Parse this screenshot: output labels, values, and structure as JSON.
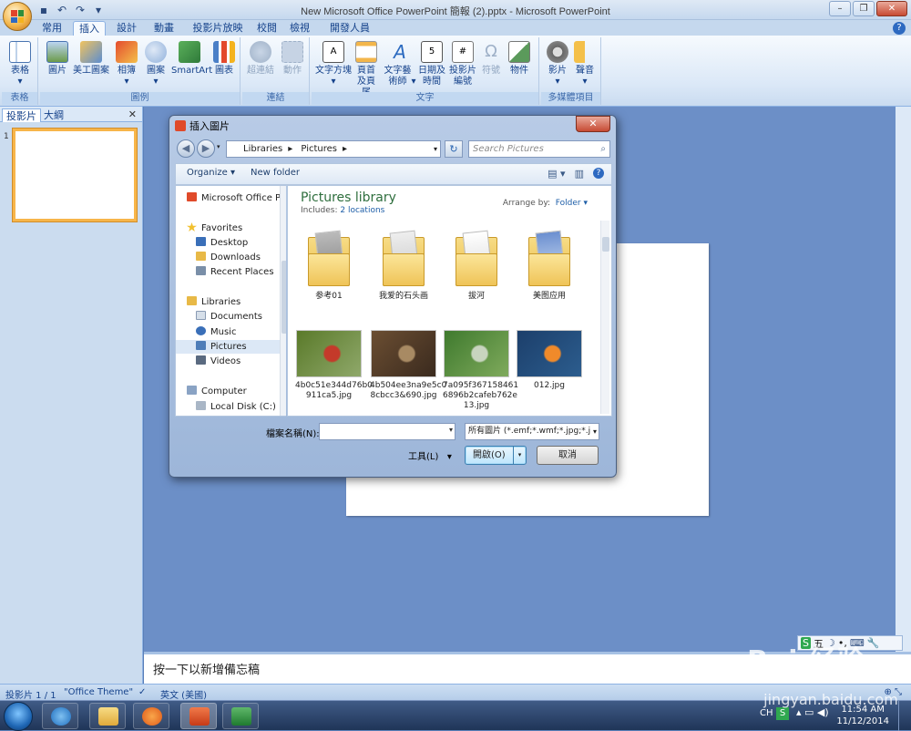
{
  "window": {
    "title": "New Microsoft Office PowerPoint 簡報 (2).pptx - Microsoft PowerPoint"
  },
  "ribbon": {
    "tabs": [
      "常用",
      "插入",
      "設計",
      "動畫",
      "投影片放映",
      "校閱",
      "檢視",
      "開發人員"
    ],
    "active_tab": "插入",
    "groups": {
      "table": {
        "label": "表格",
        "buttons": [
          "表格"
        ]
      },
      "illustrations": {
        "label": "圖例",
        "buttons": [
          "圖片",
          "美工圖案",
          "相簿",
          "圖案",
          "SmartArt",
          "圖表"
        ]
      },
      "links": {
        "label": "連結",
        "buttons": [
          "超連結",
          "動作"
        ]
      },
      "text": {
        "label": "文字",
        "buttons": [
          "文字方塊",
          "頁首及頁尾",
          "文字藝術師",
          "日期及時間",
          "投影片編號",
          "符號",
          "物件"
        ]
      },
      "media": {
        "label": "多媒體項目",
        "buttons": [
          "影片",
          "聲音"
        ]
      }
    }
  },
  "panel": {
    "tabs": [
      "投影片",
      "大綱"
    ],
    "active_tab": "投影片",
    "thumb_number": "1"
  },
  "notes": {
    "placeholder": "按一下以新增備忘稿"
  },
  "statusbar": {
    "slide": "投影片 1 / 1",
    "theme": "\"Office Theme\"",
    "language": "英文 (美國)"
  },
  "dialog": {
    "title": "插入圖片",
    "breadcrumbs": [
      "Libraries",
      "Pictures"
    ],
    "search_placeholder": "Search Pictures",
    "commands": {
      "organize": "Organize",
      "new_folder": "New folder"
    },
    "nav": {
      "top": "Microsoft Office Po",
      "favorites_header": "Favorites",
      "favorites": [
        "Desktop",
        "Downloads",
        "Recent Places"
      ],
      "libraries_header": "Libraries",
      "libraries": [
        "Documents",
        "Music",
        "Pictures",
        "Videos"
      ],
      "selected": "Pictures",
      "computer_header": "Computer",
      "computer": [
        "Local Disk (C:)"
      ]
    },
    "library": {
      "title": "Pictures library",
      "includes_label": "Includes:",
      "includes_link": "2 locations",
      "arrange_label": "Arrange by:",
      "arrange_value": "Folder"
    },
    "folders": [
      "参考01",
      "我爱的石头画",
      "拔河",
      "美图应用"
    ],
    "photos": [
      {
        "name": "4b0c51e344d76b0911ca5.jpg",
        "line1": "4b0c51e344d76b0",
        "line2": "911ca5.jpg",
        "colors": [
          "#5a7a2a",
          "#c43a2a",
          "#8fa86a"
        ]
      },
      {
        "name": "4b504ee3na9e5c08cbcc3&690.jpg",
        "line1": "4b504ee3na9e5c0",
        "line2": "8cbcc3&690.jpg",
        "colors": [
          "#6b4e32",
          "#a88a63",
          "#3a2a1e"
        ]
      },
      {
        "name": "7a095f3671584616896b2cafeb762e13.jpg",
        "line1": "7a095f367158461",
        "line2": "6896b2cafeb762e",
        "line3": "13.jpg",
        "colors": [
          "#3f7a2e",
          "#c8d4bf",
          "#7faa5c"
        ]
      },
      {
        "name": "012.jpg",
        "line1": "012.jpg",
        "colors": [
          "#1c3f6b",
          "#f08a2a",
          "#2c5d8e"
        ]
      }
    ],
    "filename_label": "檔案名稱(N):",
    "filename_value": "",
    "filetype_value": "所有圖片 (*.emf;*.wmf;*.jpg;*.j",
    "tools_label": "工具(L)",
    "open_label": "開啟(O)",
    "cancel_label": "取消"
  },
  "ime": {
    "items": [
      "S",
      "五",
      "☽",
      "•,",
      "⌨",
      "🔧"
    ]
  },
  "taskbar": {
    "lang": "CH",
    "time": "11:54 AM",
    "date": "11/12/2014"
  },
  "watermark": {
    "text1": "Bai 经验",
    "text2": "jingyan.baidu.com"
  },
  "colors": {
    "ribbon_bg": "#dbe8f7",
    "workspace": "#6c8fc7",
    "accent": "#15428b",
    "selected_thumb_border": "#f7b54a"
  }
}
